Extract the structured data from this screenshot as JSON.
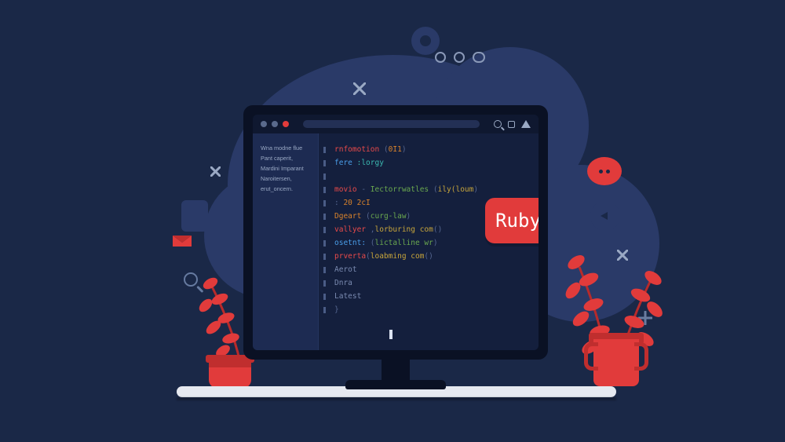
{
  "badge": {
    "label": "Ruby"
  },
  "sidebar": {
    "lines": [
      "Wna modne flue",
      "Pant caperit,",
      "Mardini Imparant",
      "Naroitersen,",
      "erut_oncern."
    ]
  },
  "editor": {
    "lines": [
      {
        "segments": [
          {
            "t": "rnfomotion",
            "c": "c-red"
          },
          {
            "t": " (",
            "c": "c-mute"
          },
          {
            "t": "0I1",
            "c": "c-orange"
          },
          {
            "t": ")",
            "c": "c-mute"
          }
        ]
      },
      {
        "segments": [
          {
            "t": "fere ",
            "c": "c-blue"
          },
          {
            "t": ":lorgy",
            "c": "c-cyan"
          }
        ]
      },
      {
        "segments": []
      },
      {
        "segments": [
          {
            "t": "movio",
            "c": "c-red"
          },
          {
            "t": " - ",
            "c": "c-mute"
          },
          {
            "t": "Iectorrwatles",
            "c": "c-green"
          },
          {
            "t": " (",
            "c": "c-mute"
          },
          {
            "t": "ily(loum",
            "c": "c-yellow"
          },
          {
            "t": ")",
            "c": "c-mute"
          }
        ]
      },
      {
        "segments": [
          {
            "t": ": ",
            "c": "c-mute"
          },
          {
            "t": "20 2cI",
            "c": "c-orange"
          }
        ]
      },
      {
        "segments": [
          {
            "t": "Dgeart",
            "c": "c-orange"
          },
          {
            "t": " (",
            "c": "c-mute"
          },
          {
            "t": "curg-law",
            "c": "c-green"
          },
          {
            "t": ")",
            "c": "c-mute"
          }
        ]
      },
      {
        "segments": [
          {
            "t": "vallyer",
            "c": "c-red"
          },
          {
            "t": " ,",
            "c": "c-mute"
          },
          {
            "t": "lorburing com",
            "c": "c-yellow"
          },
          {
            "t": "()",
            "c": "c-mute"
          }
        ]
      },
      {
        "segments": [
          {
            "t": "osetnt:",
            "c": "c-blue"
          },
          {
            "t": " (",
            "c": "c-mute"
          },
          {
            "t": "lictalline wr",
            "c": "c-green"
          },
          {
            "t": ")",
            "c": "c-mute"
          }
        ]
      },
      {
        "segments": [
          {
            "t": "prverta",
            "c": "c-red"
          },
          {
            "t": "(",
            "c": "c-mute"
          },
          {
            "t": "loabming com",
            "c": "c-yellow"
          },
          {
            "t": "()",
            "c": "c-mute"
          }
        ]
      },
      {
        "segments": [
          {
            "t": "Aerot",
            "c": "c-grey"
          }
        ]
      },
      {
        "segments": [
          {
            "t": "Dnra",
            "c": "c-grey"
          }
        ]
      },
      {
        "segments": [
          {
            "t": "Latest",
            "c": "c-grey"
          }
        ]
      },
      {
        "segments": [
          {
            "t": "}",
            "c": "c-mute"
          }
        ]
      }
    ]
  }
}
